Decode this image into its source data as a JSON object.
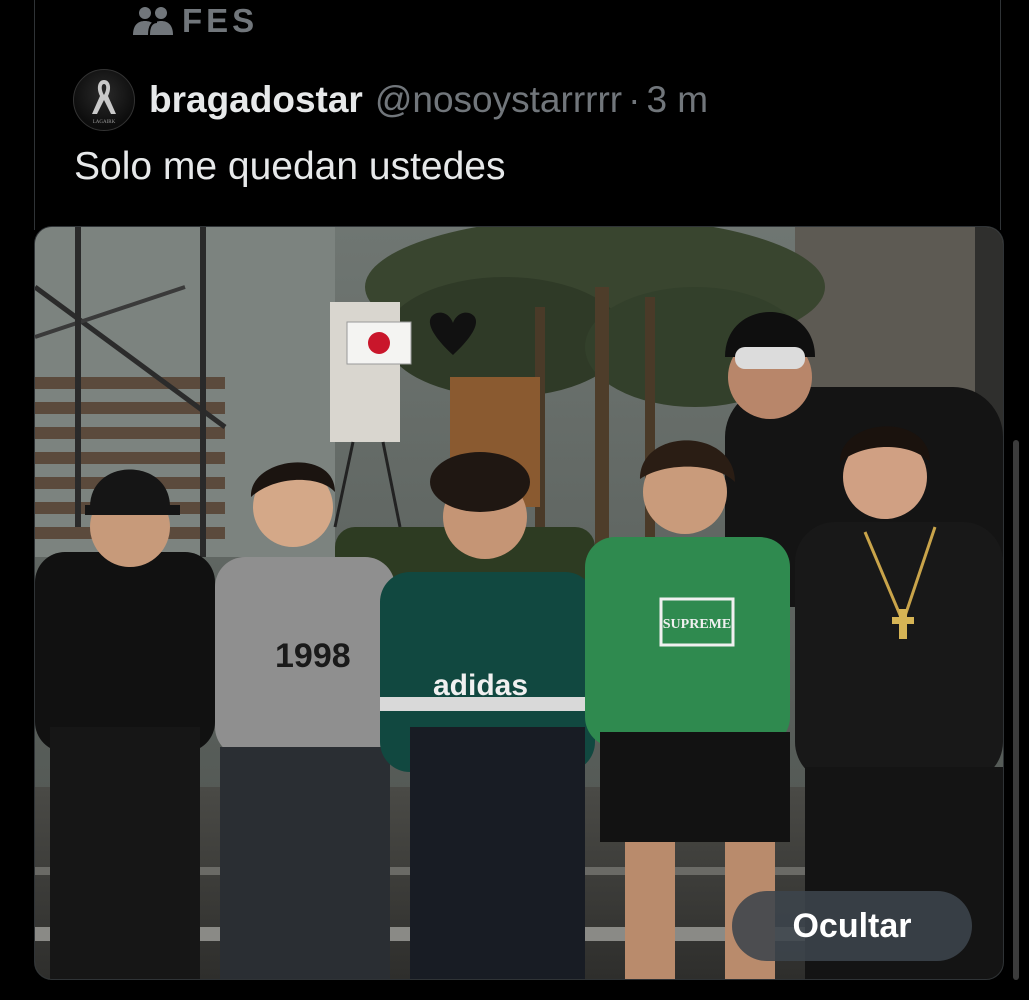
{
  "community": {
    "name": "FES",
    "icon": "people-group-icon"
  },
  "post": {
    "display_name": "bragadostar",
    "handle": "@nosoystarrrrr",
    "separator": "·",
    "time": "3 m",
    "text": "Solo me quedan ustedes",
    "avatar_icon": "ribbon-logo-icon",
    "avatar_caption": "LAGAIRK"
  },
  "media": {
    "photo_text": {
      "shirt_adidas": "adidas",
      "shirt_supreme": "SUPREME",
      "shirt_number": "1998"
    }
  },
  "actions": {
    "hide_label": "Ocultar"
  },
  "colors": {
    "background": "#000000",
    "primary_text": "#e7e9ea",
    "secondary_text": "#71767b",
    "hide_button_bg": "#3c444c"
  }
}
